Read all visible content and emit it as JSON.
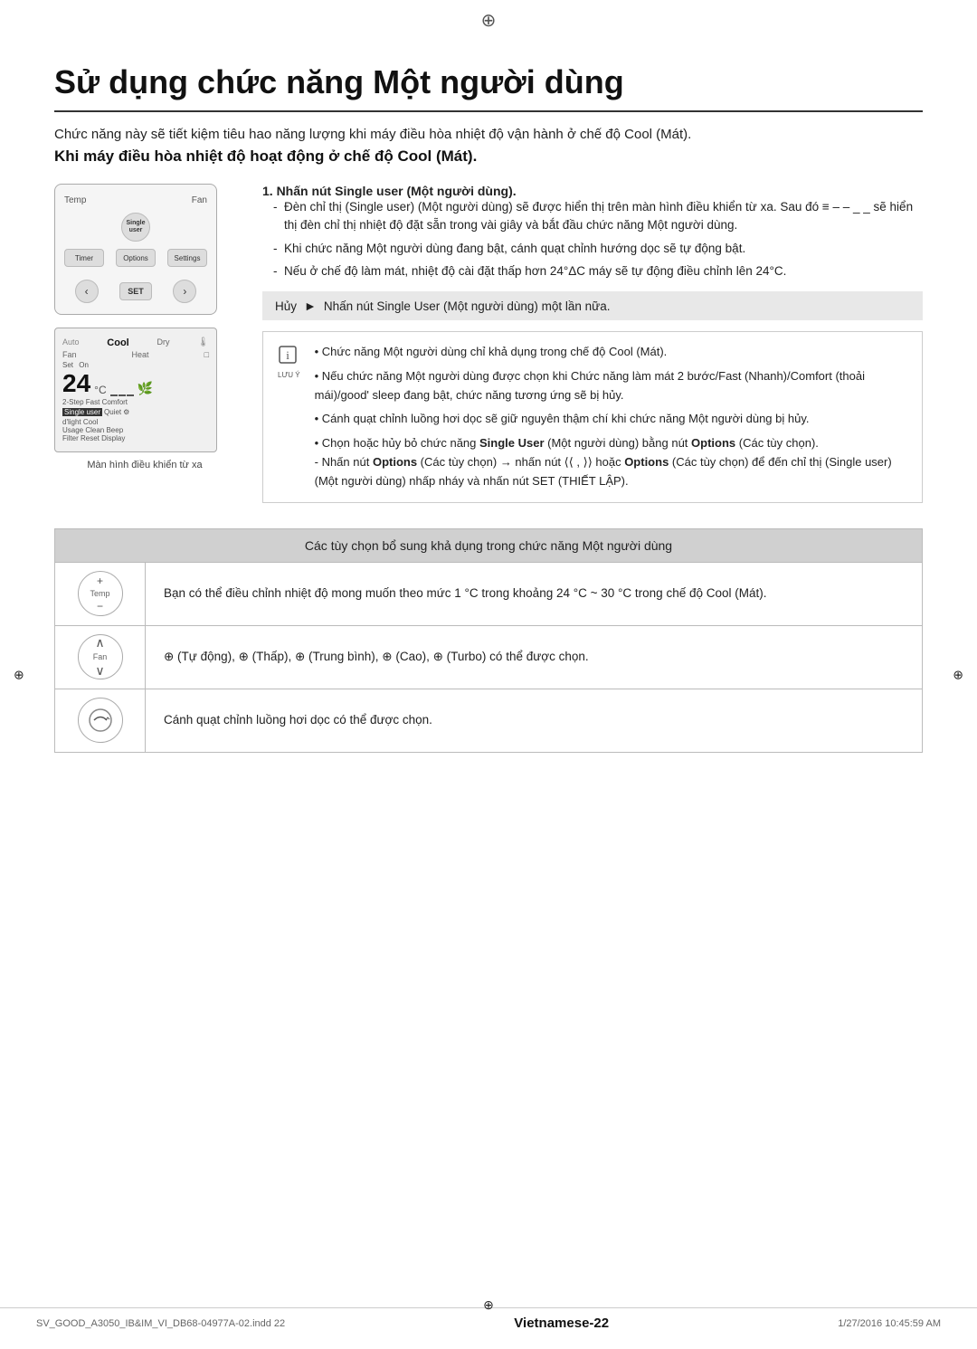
{
  "page": {
    "compass_top": "⊕",
    "compass_left_mid": "⊕",
    "compass_right_mid": "⊕",
    "compass_bottom": "⊕"
  },
  "title": "Sử dụng chức năng Một người dùng",
  "subtitle": "Chức năng này sẽ tiết kiệm tiêu hao năng lượng khi máy điều hòa nhiệt độ vận hành ở chế độ Cool (Mát).",
  "subtitle2": "Khi máy điều hòa nhiệt độ hoạt động ở chế độ Cool (Mát).",
  "steps": {
    "step1_label": "1. Nhấn nút ",
    "step1_bold": "Single user",
    "step1_after": " (Một người dùng).",
    "bullet1": "Đèn chỉ thị (Single user) (Một người dùng) sẽ được hiển thị trên màn hình điều khiển từ xa. Sau đó  ≡ – – _ _  sẽ hiển thị đèn chỉ thị nhiệt độ đặt sẵn trong vài giây và bắt đầu chức năng Một người dùng.",
    "bullet2": "Khi chức năng Một người dùng đang bật, cánh quạt chỉnh hướng dọc sẽ tự động bật.",
    "bullet3": "Nếu ở chế độ làm mát, nhiệt độ cài đặt thấp hơn 24°ΔC máy sẽ tự động điều chỉnh lên 24°C."
  },
  "cancel_label": "Hủy",
  "cancel_arrow": "►",
  "cancel_text": "Nhấn nút Single User (Một người dùng) một lần nữa.",
  "notes": [
    "Chức năng Một người dùng chỉ khả dụng trong chế độ Cool (Mát).",
    "Nếu chức năng Một người dùng được chọn khi Chức năng làm mát 2 bước/Fast (Nhanh)/Comfort (thoải mái)/good' sleep đang bật, chức năng tương ứng sẽ bị hủy.",
    "Cánh quạt chỉnh luồng hơi dọc sẽ giữ nguyên thậm chí khi chức năng Một người dùng bị hủy.",
    "Chọn hoặc hủy bỏ chức năng Single User (Một người dùng) bằng nút Options (Các tùy chọn).\n- Nhấn nút Options (Các tùy chọn) → nhấn nút ⟨⟨ , ⟩⟩ hoặc Options (Các tùy chọn) để đến chỉ thị (Single user) (Một người dùng) nhấp nháy và nhấn nút SET (THIẾT LẬP)."
  ],
  "options_table": {
    "header": "Các tùy chọn bổ sung khả dụng trong chức năng Một người dùng",
    "rows": [
      {
        "icon_type": "temp",
        "text": "Bạn có thể điều chỉnh nhiệt độ mong muốn theo mức 1 °C trong khoảng 24 °C ~ 30 °C trong chế độ Cool (Mát)."
      },
      {
        "icon_type": "fan",
        "text": "⊕ (Tự động), ⊕ (Thấp), ⊕ (Trung bình), ⊕ (Cao), ⊕ (Turbo) có thể được chọn."
      },
      {
        "icon_type": "airflow",
        "text": "Cánh quạt chỉnh luồng hơi dọc có thể được chọn."
      }
    ]
  },
  "lcd": {
    "auto": "Auto",
    "cool": "Cool",
    "dry": "Dry",
    "fan": "Fan",
    "heat": "Heat",
    "set_label": "Set",
    "on_label": "On",
    "temperature": "24",
    "temp_unit": "°C",
    "single_user": "Single user",
    "quiet": "Quiet",
    "step_fast_comfort": "2-Step Fast Comfort",
    "d_light_cool": "d'light Cool",
    "usage_clean_beep": "Usage  Clean  Beep",
    "filter_reset_display": "Filter Reset  Display"
  },
  "remote": {
    "temp_label": "Temp",
    "fan_label": "Fan",
    "single_user_label": "Single user",
    "timer_label": "Timer",
    "options_label": "Options",
    "settings_label": "Settings",
    "set_label": "SET"
  },
  "remote_caption": "Màn hình điều khiển từ xa",
  "footer": {
    "left": "SV_GOOD_A3050_IB&IM_VI_DB68-04977A-02.indd  22",
    "center": "Vietnamese-22",
    "right": "1/27/2016  10:45:59 AM"
  }
}
